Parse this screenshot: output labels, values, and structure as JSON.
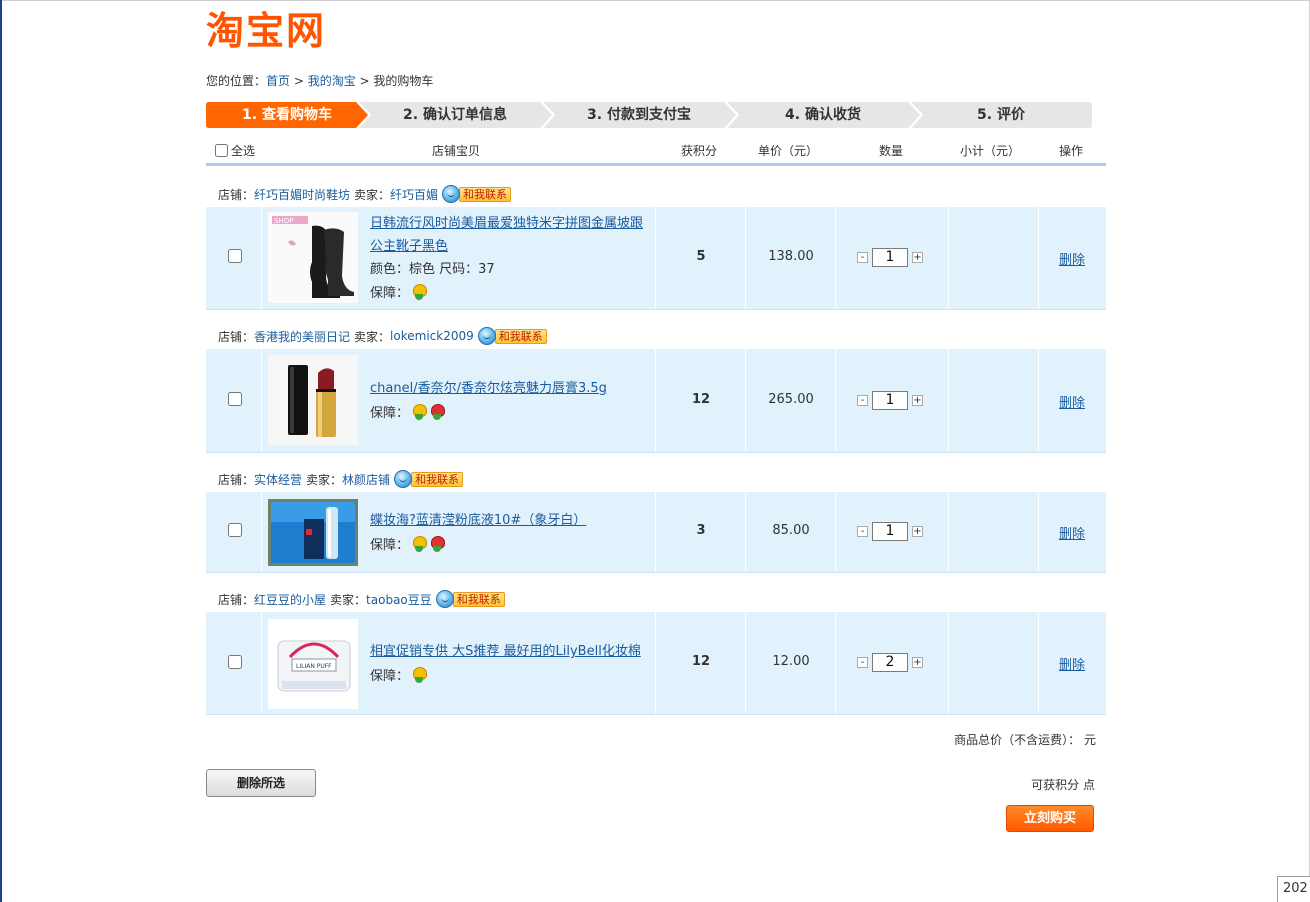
{
  "logo": {
    "text": "淘宝网"
  },
  "breadcrumb": {
    "prefix": "您的位置：",
    "home": "首页",
    "sep1": " > ",
    "my_taobao": "我的淘宝",
    "sep2": " > ",
    "current": "我的购物车"
  },
  "steps": [
    {
      "label": "1. 查看购物车",
      "active": true
    },
    {
      "label": "2. 确认订单信息",
      "active": false
    },
    {
      "label": "3. 付款到支付宝",
      "active": false
    },
    {
      "label": "4. 确认收货",
      "active": false
    },
    {
      "label": "5. 评价",
      "active": false
    }
  ],
  "table_header": {
    "select_all": "全选",
    "item": "店铺宝贝",
    "points": "获积分",
    "unit_price": "单价（元）",
    "quantity": "数量",
    "subtotal": "小计（元）",
    "action": "操作"
  },
  "labels": {
    "shop": "店铺：",
    "seller": "卖家：",
    "contact": "和我联系",
    "guarantee": "保障：",
    "delete": "删除"
  },
  "items": [
    {
      "shop_name": "纤巧百媚时尚鞋坊",
      "seller_name": "纤巧百媚",
      "title": "日韩流行风时尚美眉最爱独特米字拼图金属坡跟公主靴子黑色",
      "attrs": "颜色：棕色  尺码：37",
      "points": "5",
      "price": "138.00",
      "qty": "1",
      "guarantees": [
        "yellow"
      ]
    },
    {
      "shop_name": "香港我的美丽日记",
      "seller_name": "lokemick2009",
      "title": "chanel/香奈尔/香奈尔炫亮魅力唇膏3.5g",
      "attrs": "",
      "points": "12",
      "price": "265.00",
      "qty": "1",
      "guarantees": [
        "yellow",
        "red"
      ]
    },
    {
      "shop_name": "实体经营",
      "seller_name": "林颜店铺",
      "title": "蝶妆海?蓝清滢粉底液10#（象牙白）",
      "attrs": "",
      "points": "3",
      "price": "85.00",
      "qty": "1",
      "guarantees": [
        "yellow",
        "red"
      ]
    },
    {
      "shop_name": "红豆豆的小屋",
      "seller_name": "taobao豆豆",
      "title": "相宜促销专供 大S推荐 最好用的LilyBell化妆棉",
      "attrs": "",
      "points": "12",
      "price": "12.00",
      "qty": "2",
      "guarantees": [
        "yellow"
      ]
    }
  ],
  "summary": {
    "total_label": "商品总价（不含运费）：",
    "total_unit": " 元",
    "points_label": "可获积分",
    "points_unit": " 点"
  },
  "buttons": {
    "delete_selected": "删除所选",
    "buy_now": "立刻购买"
  },
  "corner": {
    "text": "202"
  },
  "colors": {
    "accent": "#ff5500",
    "link": "#1a5b9c",
    "row_bg": "#e2f2fd",
    "step_active": "#ff6600",
    "step_inactive": "#e6e6e6"
  }
}
